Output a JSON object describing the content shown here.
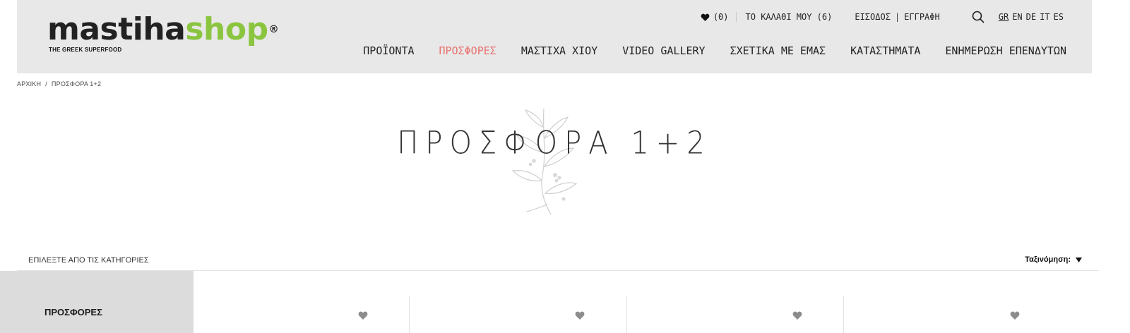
{
  "logo": {
    "part1": "masti",
    "part2": "ha",
    "part3": "shop",
    "registered": "®",
    "tagline": "THE GREEK SUPERFOOD"
  },
  "topbar": {
    "wishlist_icon": "heart-icon",
    "wishlist_count": "(0)",
    "cart_label": "ΤΟ ΚΑΛΑΘΙ ΜΟΥ (6)",
    "login_label": "ΕΙΣΟΔΟΣ",
    "separator": "|",
    "register_label": "ΕΓΓΡΑΦΗ",
    "search_icon": "search-icon",
    "languages": [
      "GR",
      "EN",
      "DE",
      "IT",
      "ES"
    ],
    "active_language": "GR"
  },
  "nav": {
    "items": [
      "ΠΡΟΪΟΝΤΑ",
      "ΠΡΟΣΦΟΡΕΣ",
      "ΜΑΣΤΙΧΑ ΧΙΟΥ",
      "VIDEO GALLERY",
      "ΣΧΕΤΙΚΑ ΜΕ ΕΜΑΣ",
      "ΚΑΤΑΣΤΗΜΑΤΑ",
      "ΕΝΗΜΕΡΩΣΗ ΕΠΕΝΔΥΤΩΝ"
    ],
    "active_item": "ΠΡΟΣΦΟΡΕΣ"
  },
  "breadcrumb": {
    "home": "ΑΡΧΙΚΗ",
    "separator": "/",
    "current": "ΠΡΟΣΦΟΡΑ 1+2"
  },
  "page": {
    "title": "ΠΡΟΣΦΟΡΑ 1+2",
    "decoration_icon": "mastic-branch-icon"
  },
  "filters": {
    "label": "ΕΠΙΛΕΞΤΕ ΑΠΟ ΤΙΣ ΚΑΤΗΓΟΡΙΕΣ",
    "sort_label": "Ταξινόμηση:",
    "sort_icon": "caret-down-icon"
  },
  "sidebar": {
    "items": [
      "ΠΡΟΣΦΟΡΕΣ"
    ]
  },
  "products": {
    "favorite_icon": "heart-icon",
    "columns": 4
  },
  "colors": {
    "header_bg": "#e8e8e8",
    "accent": "#e9706c",
    "logo_green": "#8bc540",
    "sidebar_bg": "#dcdcdc"
  }
}
